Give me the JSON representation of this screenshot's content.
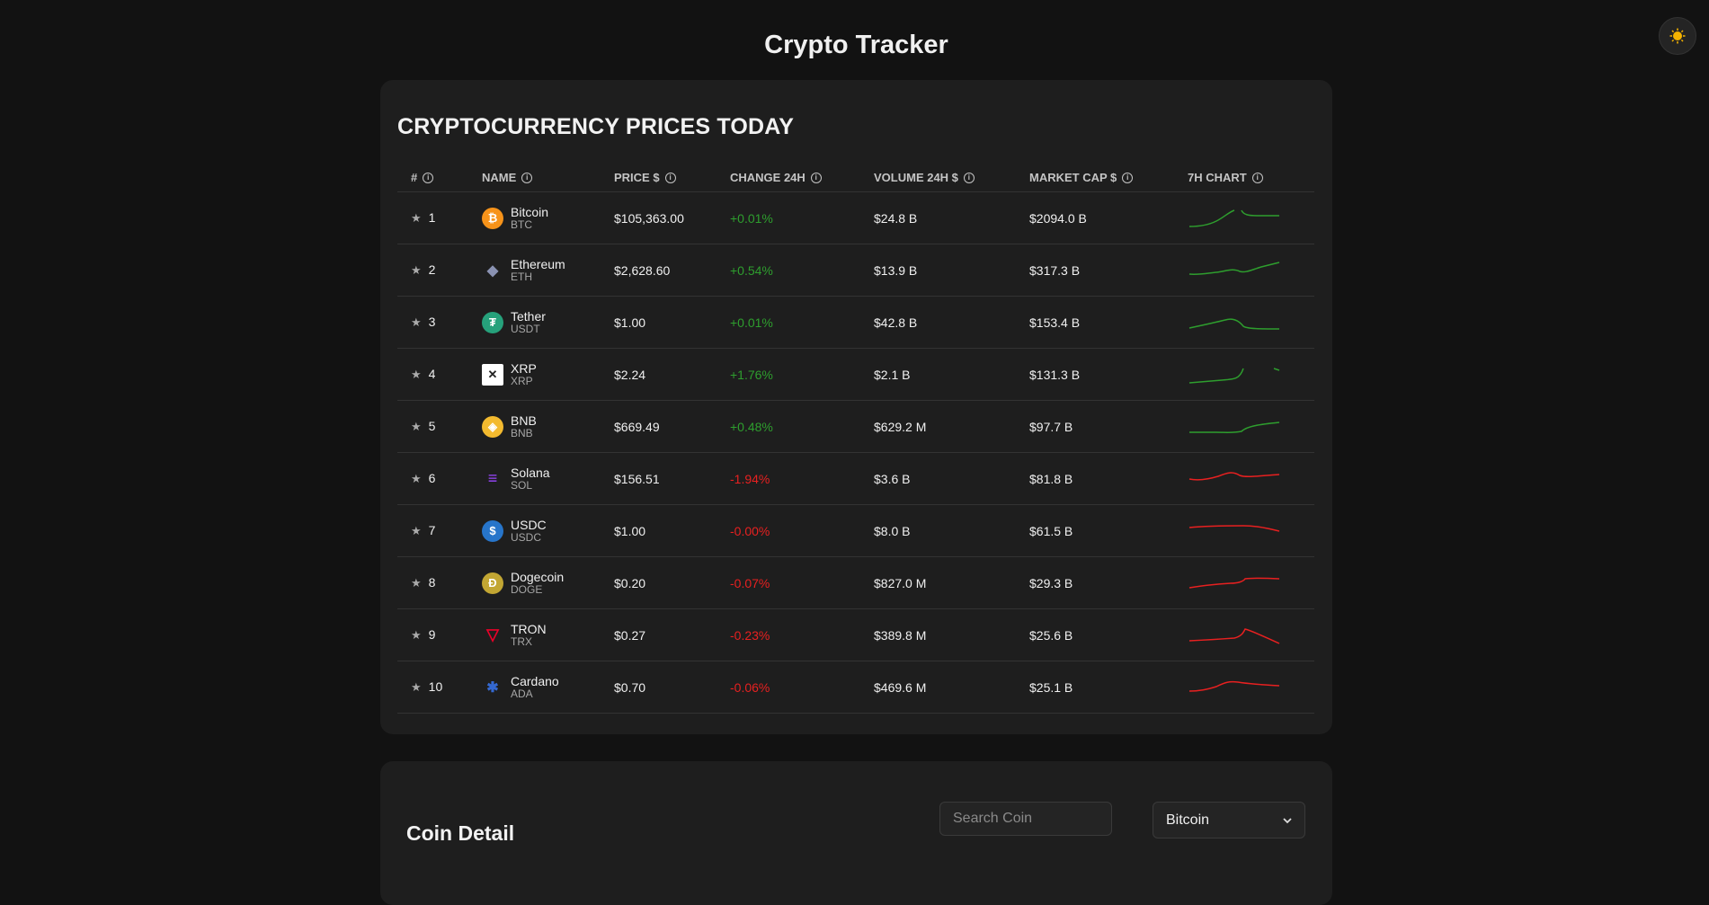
{
  "app": {
    "title": "Crypto Tracker"
  },
  "prices": {
    "section_title": "CRYPTOCURRENCY PRICES TODAY",
    "columns": [
      "#",
      "NAME",
      "PRICE $",
      "CHANGE 24H",
      "VOLUME 24H $",
      "MARKET CAP $",
      "7H CHART"
    ],
    "rows": [
      {
        "rank": "1",
        "name": "Bitcoin",
        "symbol": "BTC",
        "price": "$105,363.00",
        "change": "+0.01%",
        "direction": "up",
        "volume": "$24.8 B",
        "market_cap": "$2094.0 B",
        "icon": "bitcoin-icon",
        "icon_color": "#f7931a"
      },
      {
        "rank": "2",
        "name": "Ethereum",
        "symbol": "ETH",
        "price": "$2,628.60",
        "change": "+0.54%",
        "direction": "up",
        "volume": "$13.9 B",
        "market_cap": "$317.3 B",
        "icon": "ethereum-icon",
        "icon_color": "#8a92b2"
      },
      {
        "rank": "3",
        "name": "Tether",
        "symbol": "USDT",
        "price": "$1.00",
        "change": "+0.01%",
        "direction": "up",
        "volume": "$42.8 B",
        "market_cap": "$153.4 B",
        "icon": "tether-icon",
        "icon_color": "#26a17b"
      },
      {
        "rank": "4",
        "name": "XRP",
        "symbol": "XRP",
        "price": "$2.24",
        "change": "+1.76%",
        "direction": "up",
        "volume": "$2.1 B",
        "market_cap": "$131.3 B",
        "icon": "xrp-icon",
        "icon_color": "#ffffff"
      },
      {
        "rank": "5",
        "name": "BNB",
        "symbol": "BNB",
        "price": "$669.49",
        "change": "+0.48%",
        "direction": "up",
        "volume": "$629.2 M",
        "market_cap": "$97.7 B",
        "icon": "bnb-icon",
        "icon_color": "#f3ba2f"
      },
      {
        "rank": "6",
        "name": "Solana",
        "symbol": "SOL",
        "price": "$156.51",
        "change": "-1.94%",
        "direction": "down",
        "volume": "$3.6 B",
        "market_cap": "$81.8 B",
        "icon": "solana-icon",
        "icon_color": "#9945ff"
      },
      {
        "rank": "7",
        "name": "USDC",
        "symbol": "USDC",
        "price": "$1.00",
        "change": "-0.00%",
        "direction": "down",
        "volume": "$8.0 B",
        "market_cap": "$61.5 B",
        "icon": "usdc-icon",
        "icon_color": "#2775ca"
      },
      {
        "rank": "8",
        "name": "Dogecoin",
        "symbol": "DOGE",
        "price": "$0.20",
        "change": "-0.07%",
        "direction": "down",
        "volume": "$827.0 M",
        "market_cap": "$29.3 B",
        "icon": "dogecoin-icon",
        "icon_color": "#c2a633"
      },
      {
        "rank": "9",
        "name": "TRON",
        "symbol": "TRX",
        "price": "$0.27",
        "change": "-0.23%",
        "direction": "down",
        "volume": "$389.8 M",
        "market_cap": "$25.6 B",
        "icon": "tron-icon",
        "icon_color": "#eb0029"
      },
      {
        "rank": "10",
        "name": "Cardano",
        "symbol": "ADA",
        "price": "$0.70",
        "change": "-0.06%",
        "direction": "down",
        "volume": "$469.6 M",
        "market_cap": "$25.1 B",
        "icon": "cardano-icon",
        "icon_color": "#3468d1"
      }
    ]
  },
  "detail": {
    "title": "Coin Detail",
    "search_placeholder": "Search Coin",
    "selected_coin": "Bitcoin"
  },
  "colors": {
    "up": "#2e9e2e",
    "down": "#e82020",
    "background": "#121212",
    "card": "#1e1e1e"
  }
}
